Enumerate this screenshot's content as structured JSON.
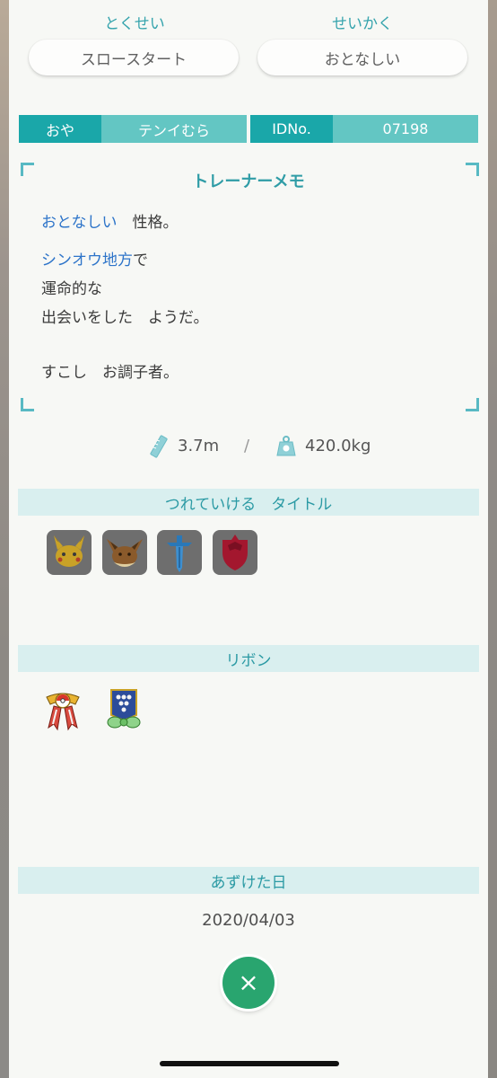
{
  "ability": {
    "header": "とくせい",
    "value": "スロースタート"
  },
  "nature": {
    "header": "せいかく",
    "value": "おとなしい"
  },
  "ot": {
    "label": "おや",
    "value": "テンイむら"
  },
  "id_no": {
    "label": "IDNo.",
    "value": "07198"
  },
  "trainer_memo": {
    "title": "トレーナーメモ",
    "nature_word": "おとなしい",
    "nature_suffix": "　性格。",
    "region": "シンオウ地方",
    "region_suffix": "で",
    "line2": "運命的な",
    "line3": "出会いをした　ようだ。",
    "line4": "すこし　お調子者。"
  },
  "size": {
    "height": "3.7m",
    "separator": "/",
    "weight": "420.0kg",
    "height_icon": "ruler-icon",
    "weight_icon": "scale-icon"
  },
  "titles_section": {
    "header": "つれていける　タイトル",
    "icons": [
      "pikachu-game-icon",
      "eevee-game-icon",
      "sword-game-icon",
      "shield-game-icon"
    ]
  },
  "ribbons_section": {
    "header": "リボン",
    "icons": [
      "pokeball-medal-ribbon-icon",
      "blue-badge-ribbon-icon"
    ]
  },
  "deposit": {
    "header": "あずけた日",
    "date": "2020/04/03"
  },
  "close_button": {
    "label": "×",
    "color": "#29a56f"
  },
  "colors": {
    "accent": "#1aa7a9",
    "accent_light": "#63c6c3",
    "blue_text": "#2d74c9",
    "section_bg": "#d9efef"
  }
}
